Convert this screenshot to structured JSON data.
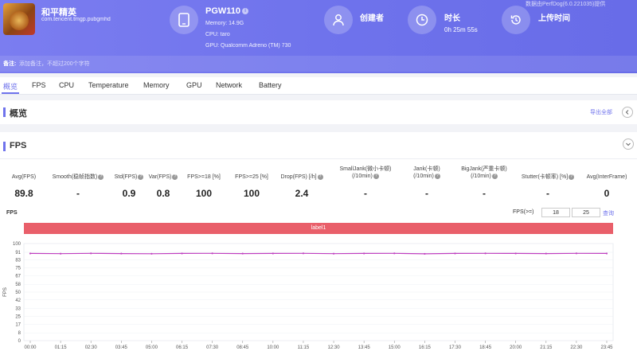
{
  "app": {
    "name": "和平精英",
    "package": "com.tencent.tmgp.pubgmhd"
  },
  "device": {
    "name": "PGW110",
    "memory": "Memory: 14.9G",
    "cpu": "CPU: taro",
    "gpu": "GPU: Qualcomm Adreno (TM) 730"
  },
  "creator": {
    "label": "创建者"
  },
  "duration": {
    "label": "时长",
    "value": "0h 25m 55s"
  },
  "upload": {
    "label": "上传时间"
  },
  "version_text": "数据由PerfDog(6.0.221035)提供",
  "remark": {
    "label": "备注:",
    "placeholder": "添加备注，不超过200个字符"
  },
  "tabs": [
    "概览",
    "FPS",
    "CPU",
    "Temperature",
    "Memory",
    "GPU",
    "Network",
    "Battery"
  ],
  "overview": {
    "title": "概览",
    "export": "导出全部"
  },
  "fps_section": {
    "title": "FPS",
    "metrics": [
      {
        "label": "Avg(FPS)",
        "value": "89.8",
        "help": false
      },
      {
        "label": "Smooth(稳帧指数)",
        "value": "-",
        "help": true
      },
      {
        "label": "Std(FPS)",
        "value": "0.9",
        "help": true
      },
      {
        "label": "Var(FPS)",
        "value": "0.8",
        "help": true
      },
      {
        "label": "FPS>=18 [%]",
        "value": "100",
        "help": false
      },
      {
        "label": "FPS>=25 [%]",
        "value": "100",
        "help": false
      },
      {
        "label": "Drop(FPS) [/h]",
        "value": "2.4",
        "help": true
      },
      {
        "label": "SmallJank(微小卡顿)",
        "label2": "(/10min)",
        "value": "-",
        "help": true
      },
      {
        "label": "Jank(卡顿)",
        "label2": "(/10min)",
        "value": "-",
        "help": true
      },
      {
        "label": "BigJank(严重卡顿)",
        "label2": "(/10min)",
        "value": "-",
        "help": true
      },
      {
        "label": "Stutter(卡顿率) [%]",
        "value": "-",
        "help": true
      },
      {
        "label": "Avg(InterFrame)",
        "value": "0",
        "help": false
      }
    ],
    "chart_title": "FPS",
    "threshold_label": "FPS(>=)",
    "threshold_1": "18",
    "threshold_2": "25",
    "query": "查询",
    "label_bar": "label1"
  },
  "colors": {
    "accent": "#6f73ec",
    "label_bar": "#e95f6a",
    "fps_line": "#c040c0"
  },
  "chart_data": {
    "type": "line",
    "title": "FPS",
    "ylabel": "FPS",
    "ylim": [
      0,
      100
    ],
    "yticks": [
      0,
      8,
      17,
      25,
      33,
      42,
      50,
      58,
      67,
      75,
      83,
      91,
      100
    ],
    "categories": [
      "00:00",
      "01:15",
      "02:30",
      "03:45",
      "05:00",
      "06:15",
      "07:30",
      "08:45",
      "10:00",
      "11:15",
      "12:30",
      "13:45",
      "15:00",
      "16:15",
      "17:30",
      "18:45",
      "20:00",
      "21:15",
      "22:30",
      "23:45"
    ],
    "series": [
      {
        "values": [
          89.8,
          89.6,
          89.9,
          89.7,
          89.5,
          89.8,
          89.9,
          89.7,
          89.8,
          89.9,
          89.6,
          89.8,
          89.9,
          89.4,
          89.8,
          89.9,
          89.8,
          89.7,
          89.9,
          89.8
        ]
      }
    ],
    "grid": true
  }
}
